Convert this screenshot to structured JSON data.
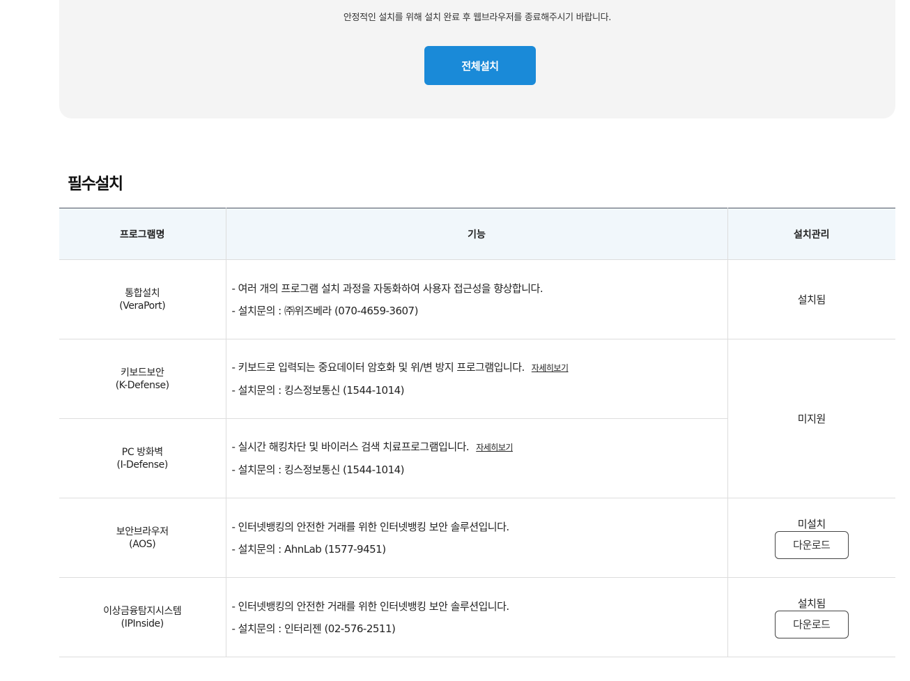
{
  "install_panel": {
    "notice": "안정적인 설치를 위해 설치 완료 후 웹브라우저를 종료해주시기 바랍니다.",
    "install_all_label": "전체설치",
    "accent_color": "#1a8ad8"
  },
  "section": {
    "title": "필수설치"
  },
  "table": {
    "headers": [
      "프로그램명",
      "기능",
      "설치관리"
    ],
    "rows": [
      {
        "name": "통합설치",
        "code": "(VeraPort)",
        "func": "- 여러 개의 프로그램 설치 과정을 자동화하여 사용자 접근성을 향상합니다.",
        "contact": "- 설치문의 : ㈜위즈베라 (070-4659-3607)",
        "status": "설치됨"
      },
      {
        "name": "키보드보안",
        "code": "(K-Defense)",
        "func": "- 키보드로 입력되는 중요데이터 암호화 및 위/변 방지 프로그램입니다.",
        "more": "자세히보기",
        "contact": "- 설치문의 : 킹스정보통신 (1544-1014)",
        "status": "미지원"
      },
      {
        "name": "PC 방화벽",
        "code": "(I-Defense)",
        "func": "- 실시간 해킹차단 및 바이러스 검색 치료프로그램입니다.",
        "more": "자세히보기",
        "contact": "- 설치문의 : 킹스정보통신 (1544-1014)"
      },
      {
        "name": "보안브라우저",
        "code": "(AOS)",
        "func": "- 인터넷뱅킹의 안전한 거래를 위한 인터넷뱅킹 보안 솔루션입니다.",
        "contact": "- 설치문의 : AhnLab (1577-9451)",
        "status": "미설치",
        "button": "다운로드"
      },
      {
        "name": "이상금융탐지시스템",
        "code": "(IPInside)",
        "func": "- 인터넷뱅킹의 안전한 거래를 위한 인터넷뱅킹 보안 솔루션입니다.",
        "contact": "- 설치문의 : 인터리젠 (02-576-2511)",
        "status": "설치됨",
        "button": "다운로드"
      }
    ]
  }
}
